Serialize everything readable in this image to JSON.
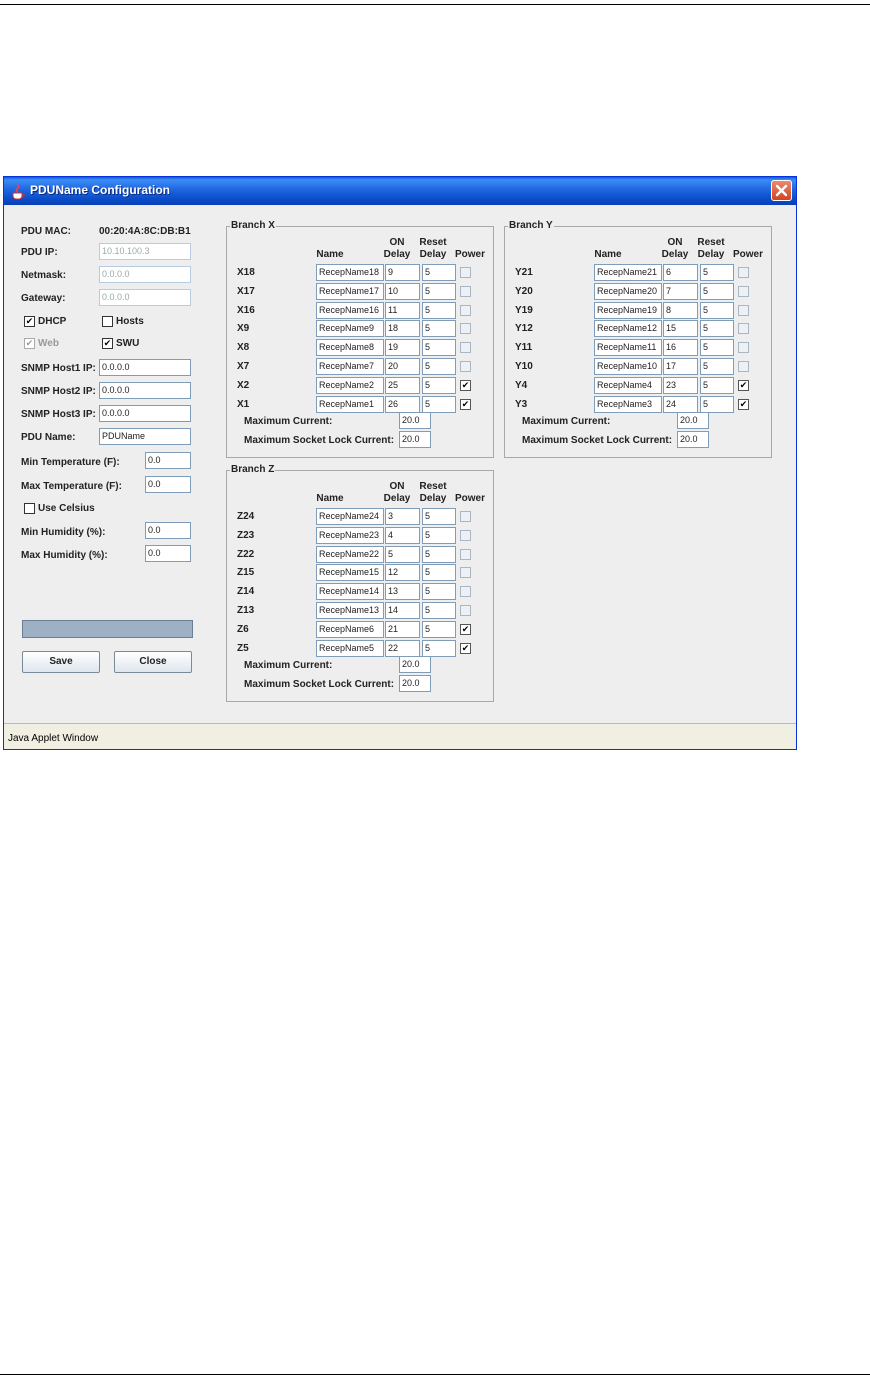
{
  "window": {
    "title": "PDUName Configuration",
    "status_bar": "Java Applet Window"
  },
  "left": {
    "pdu_mac_label": "PDU MAC:",
    "pdu_mac_value": "00:20:4A:8C:DB:B1",
    "pdu_ip_label": "PDU IP:",
    "pdu_ip_value": "10.10.100.3",
    "netmask_label": "Netmask:",
    "netmask_value": "0.0.0.0",
    "gateway_label": "Gateway:",
    "gateway_value": "0.0.0.0",
    "dhcp_label": "DHCP",
    "dhcp_checked": true,
    "hosts_label": "Hosts",
    "hosts_checked": false,
    "web_label": "Web",
    "web_checked": true,
    "swu_label": "SWU",
    "swu_checked": true,
    "snmp1_label": "SNMP Host1 IP:",
    "snmp1_value": "0.0.0.0",
    "snmp2_label": "SNMP Host2 IP:",
    "snmp2_value": "0.0.0.0",
    "snmp3_label": "SNMP Host3 IP:",
    "snmp3_value": "0.0.0.0",
    "pdu_name_label": "PDU Name:",
    "pdu_name_value": "PDUName",
    "min_temp_label": "Min Temperature (F):",
    "min_temp_value": "0.0",
    "max_temp_label": "Max Temperature (F):",
    "max_temp_value": "0.0",
    "use_celsius_label": "Use Celsius",
    "use_celsius_checked": false,
    "min_hum_label": "Min Humidity (%):",
    "min_hum_value": "0.0",
    "max_hum_label": "Max Humidity (%):",
    "max_hum_value": "0.0",
    "save_label": "Save",
    "close_label": "Close"
  },
  "headers": {
    "name": "Name",
    "on": "ON",
    "delay": "Delay",
    "reset": "Reset",
    "power": "Power"
  },
  "branches": {
    "x": {
      "title": "Branch X",
      "max_current_label": "Maximum Current:",
      "max_current_value": "20.0",
      "max_lock_label": "Maximum Socket Lock Current:",
      "max_lock_value": "20.0",
      "rows": [
        {
          "id": "X18",
          "name": "RecepName18",
          "on": "9",
          "reset": "5",
          "power": false
        },
        {
          "id": "X17",
          "name": "RecepName17",
          "on": "10",
          "reset": "5",
          "power": false
        },
        {
          "id": "X16",
          "name": "RecepName16",
          "on": "11",
          "reset": "5",
          "power": false
        },
        {
          "id": "X9",
          "name": "RecepName9",
          "on": "18",
          "reset": "5",
          "power": false
        },
        {
          "id": "X8",
          "name": "RecepName8",
          "on": "19",
          "reset": "5",
          "power": false
        },
        {
          "id": "X7",
          "name": "RecepName7",
          "on": "20",
          "reset": "5",
          "power": false
        },
        {
          "id": "X2",
          "name": "RecepName2",
          "on": "25",
          "reset": "5",
          "power": true
        },
        {
          "id": "X1",
          "name": "RecepName1",
          "on": "26",
          "reset": "5",
          "power": true
        }
      ]
    },
    "y": {
      "title": "Branch Y",
      "max_current_label": "Maximum Current:",
      "max_current_value": "20.0",
      "max_lock_label": "Maximum Socket Lock Current:",
      "max_lock_value": "20.0",
      "rows": [
        {
          "id": "Y21",
          "name": "RecepName21",
          "on": "6",
          "reset": "5",
          "power": false
        },
        {
          "id": "Y20",
          "name": "RecepName20",
          "on": "7",
          "reset": "5",
          "power": false
        },
        {
          "id": "Y19",
          "name": "RecepName19",
          "on": "8",
          "reset": "5",
          "power": false
        },
        {
          "id": "Y12",
          "name": "RecepName12",
          "on": "15",
          "reset": "5",
          "power": false
        },
        {
          "id": "Y11",
          "name": "RecepName11",
          "on": "16",
          "reset": "5",
          "power": false
        },
        {
          "id": "Y10",
          "name": "RecepName10",
          "on": "17",
          "reset": "5",
          "power": false
        },
        {
          "id": "Y4",
          "name": "RecepName4",
          "on": "23",
          "reset": "5",
          "power": true
        },
        {
          "id": "Y3",
          "name": "RecepName3",
          "on": "24",
          "reset": "5",
          "power": true
        }
      ]
    },
    "z": {
      "title": "Branch Z",
      "max_current_label": "Maximum Current:",
      "max_current_value": "20.0",
      "max_lock_label": "Maximum Socket Lock Current:",
      "max_lock_value": "20.0",
      "rows": [
        {
          "id": "Z24",
          "name": "RecepName24",
          "on": "3",
          "reset": "5",
          "power": false
        },
        {
          "id": "Z23",
          "name": "RecepName23",
          "on": "4",
          "reset": "5",
          "power": false
        },
        {
          "id": "Z22",
          "name": "RecepName22",
          "on": "5",
          "reset": "5",
          "power": false
        },
        {
          "id": "Z15",
          "name": "RecepName15",
          "on": "12",
          "reset": "5",
          "power": false
        },
        {
          "id": "Z14",
          "name": "RecepName14",
          "on": "13",
          "reset": "5",
          "power": false
        },
        {
          "id": "Z13",
          "name": "RecepName13",
          "on": "14",
          "reset": "5",
          "power": false
        },
        {
          "id": "Z6",
          "name": "RecepName6",
          "on": "21",
          "reset": "5",
          "power": true
        },
        {
          "id": "Z5",
          "name": "RecepName5",
          "on": "22",
          "reset": "5",
          "power": true
        }
      ]
    }
  }
}
